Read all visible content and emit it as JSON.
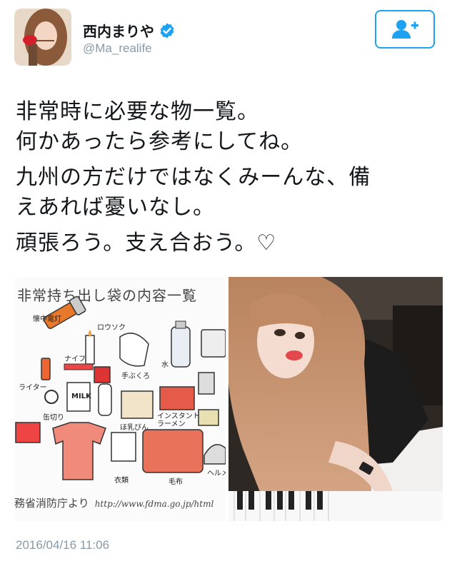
{
  "user": {
    "display_name": "西内まりや",
    "handle": "@Ma_realife",
    "verified": true
  },
  "follow_button": {
    "icon": "add-user-icon",
    "color": "#1da1f2"
  },
  "tweet": {
    "lines": [
      "非常時に必要な物一覧。",
      "何かあったら参考にしてね。",
      "九州の方だけではなくみーんな、備",
      "えあれば憂いなし。",
      "頑張ろう。支え合おう。♡"
    ],
    "timestamp": "2016/04/16 11:06"
  },
  "media": {
    "left_image": {
      "title": "非常持ち出し袋の内容一覧",
      "labels": {
        "flashlight": "懐中電灯",
        "candle": "ロウソク",
        "knife": "ナイフ",
        "gloves": "手ぶくろ",
        "water": "水",
        "lighter": "ライター",
        "can_opener": "缶切り",
        "baby_bottle": "ほ乳びん",
        "instant_noodles": "インスタント\nラーメン",
        "clothes": "衣類",
        "blanket": "毛布",
        "helmet": "ヘルメ",
        "milk": "MILK"
      },
      "source": "務省消防庁より",
      "url": "http://www.fdma.go.jp/html"
    },
    "right_image": {
      "icon": "selfie-photo"
    }
  }
}
